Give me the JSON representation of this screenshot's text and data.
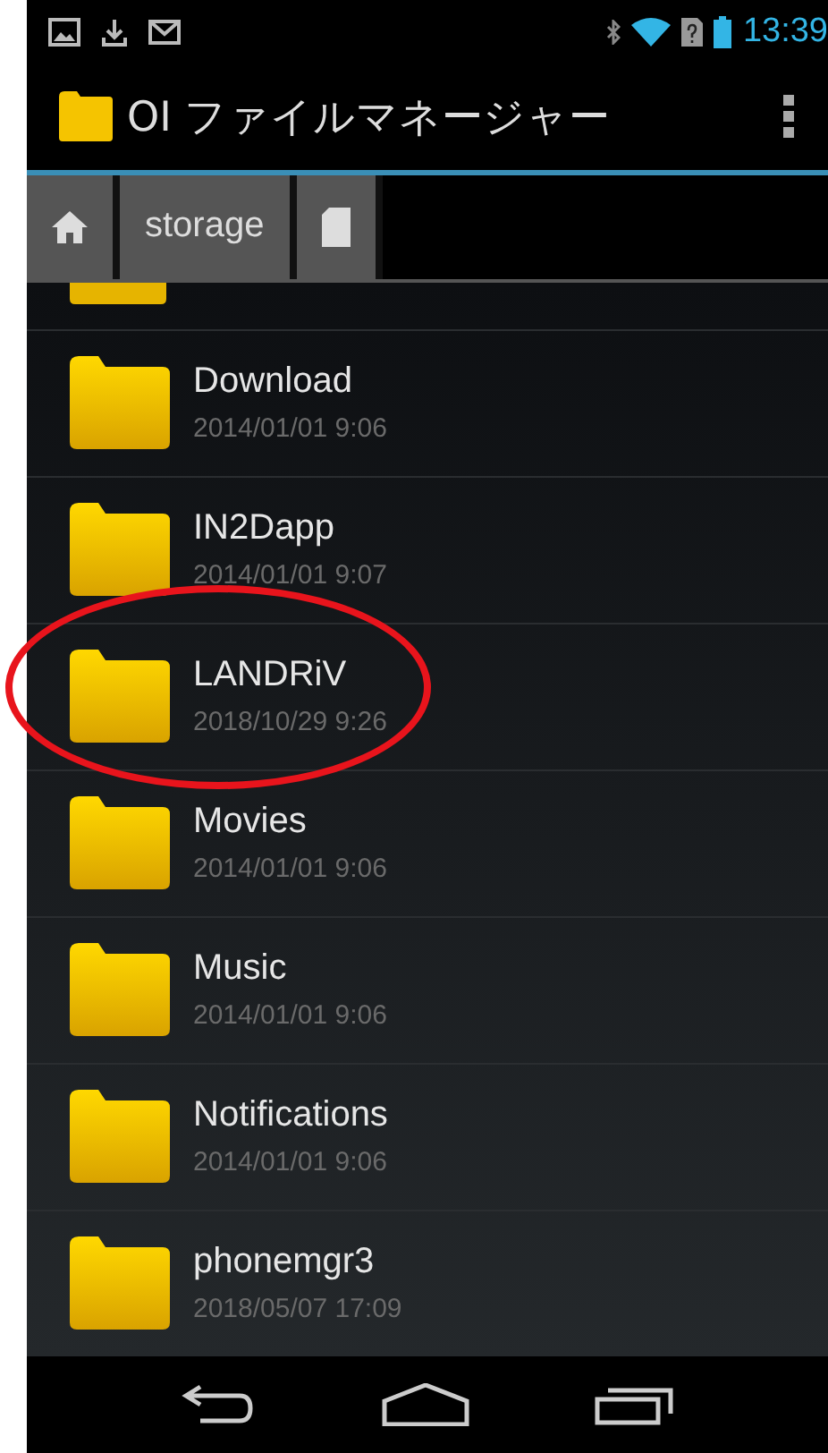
{
  "status_bar": {
    "time": "13:39"
  },
  "app_bar": {
    "title": "OI ファイルマネージャー"
  },
  "breadcrumb": [
    {
      "kind": "home"
    },
    {
      "kind": "text",
      "label": "storage"
    },
    {
      "kind": "sdcard"
    }
  ],
  "files": [
    {
      "name": "Download",
      "modified": "2014/01/01 9:06",
      "circled": false
    },
    {
      "name": "IN2Dapp",
      "modified": "2014/01/01 9:07",
      "circled": false
    },
    {
      "name": "LANDRiV",
      "modified": "2018/10/29 9:26",
      "circled": true
    },
    {
      "name": "Movies",
      "modified": "2014/01/01 9:06",
      "circled": false
    },
    {
      "name": "Music",
      "modified": "2014/01/01 9:06",
      "circled": false
    },
    {
      "name": "Notifications",
      "modified": "2014/01/01 9:06",
      "circled": false
    },
    {
      "name": "phonemgr3",
      "modified": "2018/05/07 17:09",
      "circled": false
    }
  ]
}
